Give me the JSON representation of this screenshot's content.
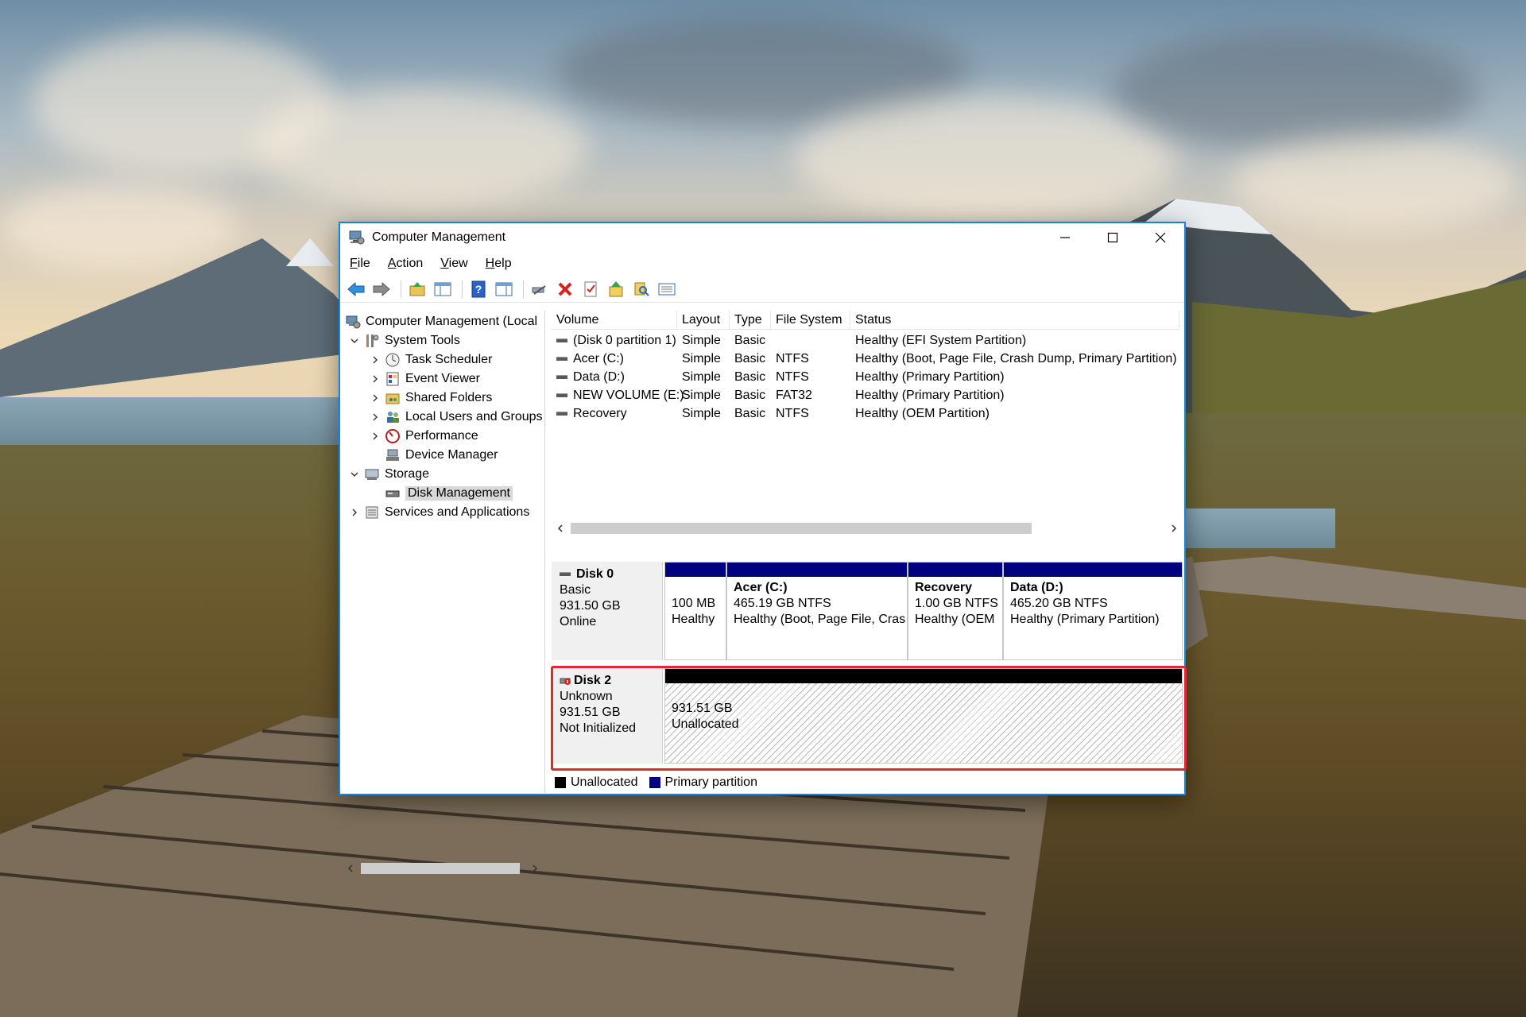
{
  "window": {
    "title": "Computer Management",
    "controls": {
      "minimize": "minimize",
      "maximize": "maximize",
      "close": "close"
    }
  },
  "menu": {
    "file": {
      "first": "F",
      "rest": "ile"
    },
    "action": {
      "first": "A",
      "rest": "ction"
    },
    "view": {
      "first": "V",
      "rest": "iew"
    },
    "help": {
      "first": "H",
      "rest": "elp"
    }
  },
  "toolbar_icons": [
    "back-arrow-icon",
    "forward-arrow-icon",
    "up-folder-icon",
    "show-hide-tree-icon",
    "help-icon",
    "show-hide-action-pane-icon",
    "connect-icon",
    "delete-icon",
    "properties-icon",
    "export-icon",
    "search-icon",
    "details-icon"
  ],
  "tree": {
    "root": "Computer Management (Local",
    "system_tools": "System Tools",
    "task_scheduler": "Task Scheduler",
    "event_viewer": "Event Viewer",
    "shared_folders": "Shared Folders",
    "local_users": "Local Users and Groups",
    "performance": "Performance",
    "device_manager": "Device Manager",
    "storage": "Storage",
    "disk_management": "Disk Management",
    "services": "Services and Applications"
  },
  "volumes": {
    "columns": [
      "Volume",
      "Layout",
      "Type",
      "File System",
      "Status"
    ],
    "rows": [
      {
        "volume": "(Disk 0 partition 1)",
        "layout": "Simple",
        "type": "Basic",
        "fs": "",
        "status": "Healthy (EFI System Partition)"
      },
      {
        "volume": "Acer (C:)",
        "layout": "Simple",
        "type": "Basic",
        "fs": "NTFS",
        "status": "Healthy (Boot, Page File, Crash Dump, Primary Partition)"
      },
      {
        "volume": "Data (D:)",
        "layout": "Simple",
        "type": "Basic",
        "fs": "NTFS",
        "status": "Healthy (Primary Partition)"
      },
      {
        "volume": "NEW VOLUME (E:)",
        "layout": "Simple",
        "type": "Basic",
        "fs": "FAT32",
        "status": "Healthy (Primary Partition)"
      },
      {
        "volume": "Recovery",
        "layout": "Simple",
        "type": "Basic",
        "fs": "NTFS",
        "status": "Healthy (OEM Partition)"
      }
    ]
  },
  "disk0": {
    "name": "Disk 0",
    "kind": "Basic",
    "size": "931.50 GB",
    "state": "Online",
    "partitions": [
      {
        "name": "",
        "size": "100 MB",
        "status": "Healthy"
      },
      {
        "name": "Acer  (C:)",
        "size": "465.19 GB NTFS",
        "status": "Healthy (Boot, Page File, Cras"
      },
      {
        "name": "Recovery",
        "size": "1.00 GB NTFS",
        "status": "Healthy (OEM"
      },
      {
        "name": "Data  (D:)",
        "size": "465.20 GB NTFS",
        "status": "Healthy (Primary Partition)"
      }
    ]
  },
  "disk2": {
    "name": "Disk 2",
    "kind": "Unknown",
    "size": "931.51 GB",
    "state": "Not Initialized",
    "unallocated_size": "931.51 GB",
    "unallocated_label": "Unallocated"
  },
  "legend": {
    "unallocated": "Unallocated",
    "primary": "Primary partition"
  },
  "colors": {
    "accent": "#1883d7",
    "primary_partition": "#000080",
    "unallocated": "#000000",
    "highlight": "#e0282f"
  }
}
